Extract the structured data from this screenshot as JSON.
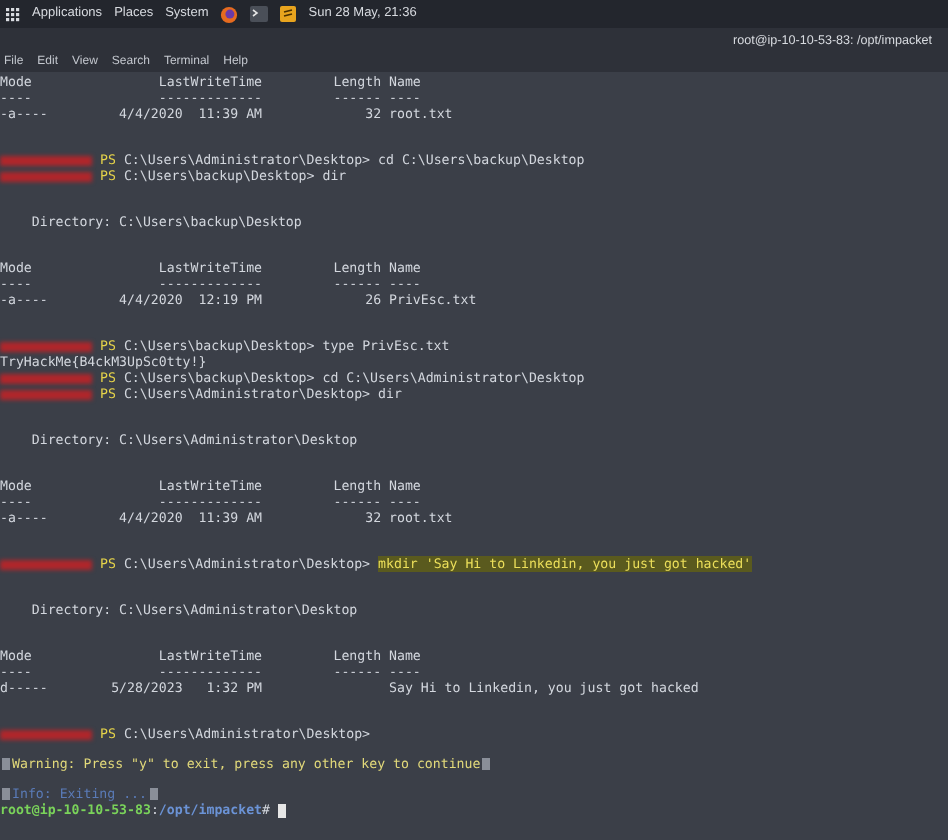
{
  "top_panel": {
    "menus": [
      "Applications",
      "Places",
      "System"
    ],
    "clock": "Sun 28 May, 21:36"
  },
  "window": {
    "title": "root@ip-10-10-53-83: /opt/impacket"
  },
  "menu_bar": [
    "File",
    "Edit",
    "View",
    "Search",
    "Terminal",
    "Help"
  ],
  "terminal": {
    "blocks": [
      {
        "lines": [
          {
            "kind": "text",
            "text": "Mode                LastWriteTime         Length Name"
          },
          {
            "kind": "text",
            "text": "----                -------------         ------ ----"
          },
          {
            "kind": "text",
            "text": "-a----         4/4/2020  11:39 AM             32 root.txt"
          }
        ]
      },
      {
        "lines": [
          {
            "kind": "prompt",
            "ps": "PS",
            "path": "C:\\Users\\Administrator\\Desktop>",
            "command": "cd C:\\Users\\backup\\Desktop",
            "highlighted": false
          },
          {
            "kind": "prompt",
            "ps": "PS",
            "path": "C:\\Users\\backup\\Desktop>",
            "command": "dir",
            "highlighted": false
          }
        ]
      },
      {
        "lines": [
          {
            "kind": "text",
            "text": "    Directory: C:\\Users\\backup\\Desktop"
          }
        ]
      },
      {
        "lines": [
          {
            "kind": "text",
            "text": "Mode                LastWriteTime         Length Name"
          },
          {
            "kind": "text",
            "text": "----                -------------         ------ ----"
          },
          {
            "kind": "text",
            "text": "-a----         4/4/2020  12:19 PM             26 PrivEsc.txt"
          }
        ]
      },
      {
        "lines": [
          {
            "kind": "prompt",
            "ps": "PS",
            "path": "C:\\Users\\backup\\Desktop>",
            "command": "type PrivEsc.txt",
            "highlighted": false
          },
          {
            "kind": "text",
            "text": "TryHackMe{B4ckM3UpSc0tty!}"
          },
          {
            "kind": "prompt",
            "ps": "PS",
            "path": "C:\\Users\\backup\\Desktop>",
            "command": "cd C:\\Users\\Administrator\\Desktop",
            "highlighted": false
          },
          {
            "kind": "prompt",
            "ps": "PS",
            "path": "C:\\Users\\Administrator\\Desktop>",
            "command": "dir",
            "highlighted": false
          }
        ]
      },
      {
        "lines": [
          {
            "kind": "text",
            "text": "    Directory: C:\\Users\\Administrator\\Desktop"
          }
        ]
      },
      {
        "lines": [
          {
            "kind": "text",
            "text": "Mode                LastWriteTime         Length Name"
          },
          {
            "kind": "text",
            "text": "----                -------------         ------ ----"
          },
          {
            "kind": "text",
            "text": "-a----         4/4/2020  11:39 AM             32 root.txt"
          }
        ]
      },
      {
        "lines": [
          {
            "kind": "prompt",
            "ps": "PS",
            "path": "C:\\Users\\Administrator\\Desktop>",
            "command": "mkdir 'Say Hi to Linkedin, you just got hacked'",
            "highlighted": true
          }
        ]
      },
      {
        "lines": [
          {
            "kind": "text",
            "text": "    Directory: C:\\Users\\Administrator\\Desktop"
          }
        ]
      },
      {
        "lines": [
          {
            "kind": "text",
            "text": "Mode                LastWriteTime         Length Name"
          },
          {
            "kind": "text",
            "text": "----                -------------         ------ ----"
          },
          {
            "kind": "text",
            "text": "d-----        5/28/2023   1:32 PM                Say Hi to Linkedin, you just got hacked"
          }
        ]
      },
      {
        "lines": [
          {
            "kind": "prompt",
            "ps": "PS",
            "path": "C:\\Users\\Administrator\\Desktop>"
          }
        ]
      },
      {
        "lines": [
          {
            "kind": "warning",
            "text": "Warning: Press \"y\" to exit, press any other key to continue"
          }
        ]
      },
      {
        "lines": [
          {
            "kind": "info",
            "text": "Info: Exiting ..."
          },
          {
            "kind": "shell",
            "user": "root@ip-10-10-53-83",
            "sep": ":",
            "cwd": "/opt/impacket",
            "symbol": "#"
          }
        ]
      }
    ]
  }
}
